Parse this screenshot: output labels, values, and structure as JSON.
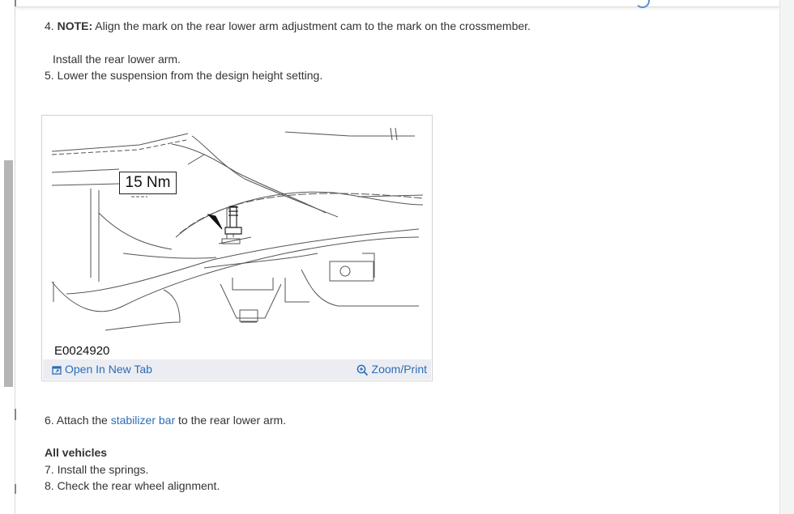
{
  "steps": {
    "step4_num": "4.",
    "step4_note_label": "NOTE:",
    "step4_note_text": "Align the mark on the rear lower arm adjustment cam to the mark on the crossmember.",
    "step4_sub": "Install the rear lower arm.",
    "step5": "5. Lower the suspension from the design height setting.",
    "step6_prefix": "6. Attach the ",
    "step6_link": "stabilizer bar",
    "step6_suffix": " to the rear lower arm.",
    "section_heading": "All vehicles",
    "step7": "7. Install the springs.",
    "step8": "8. Check the rear wheel alignment."
  },
  "figure": {
    "torque_label": "15 Nm",
    "code": "E0024920",
    "open_tab_label": "Open In New Tab",
    "zoom_label": "Zoom/Print",
    "open_tab_icon": "open-new-tab-icon",
    "zoom_icon": "magnifier-plus-icon"
  },
  "colors": {
    "link": "#2a6db5",
    "text": "#333333",
    "figure_footer": "#ecedf3"
  }
}
